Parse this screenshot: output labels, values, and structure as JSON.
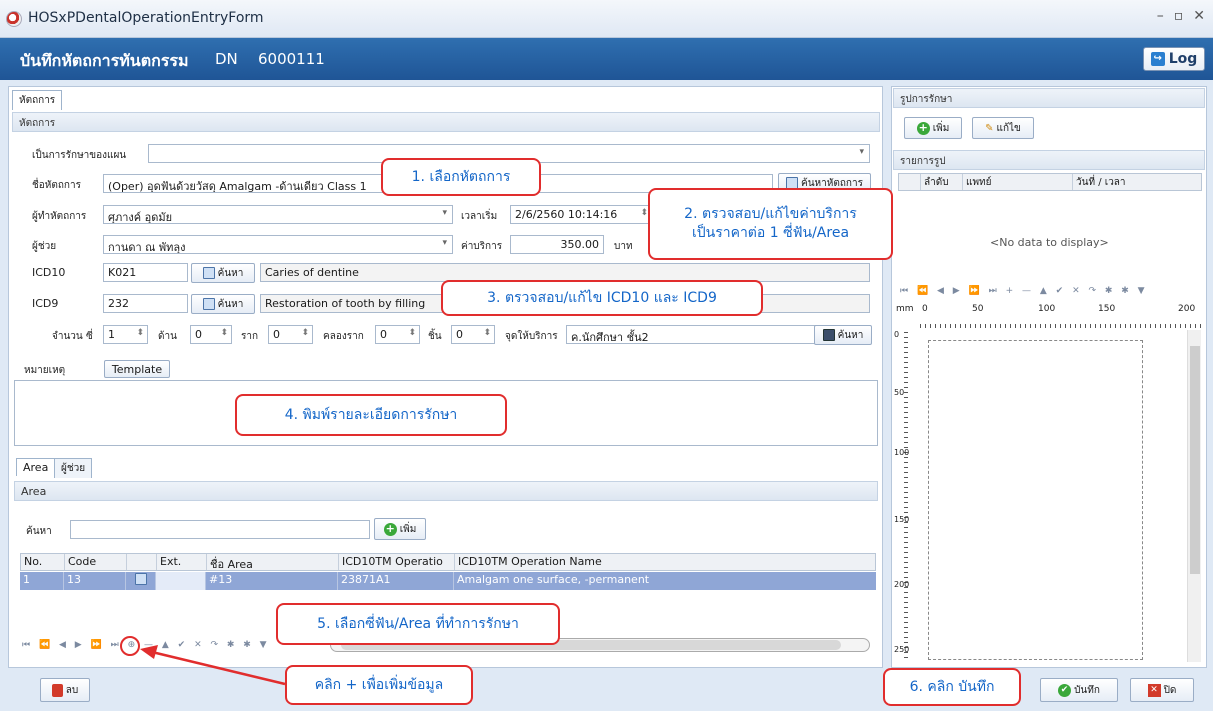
{
  "window": {
    "title": "HOSxPDentalOperationEntryForm",
    "controls": [
      "–",
      "▫",
      "✕"
    ]
  },
  "header": {
    "title": "บันทึกหัตถการทันตกรรม",
    "dn_label": "DN",
    "dn_value": "6000111",
    "log_label": "Log"
  },
  "left": {
    "tab": "หัตถการ",
    "group": "หัตถการ",
    "fields": {
      "plan_label": "เป็นการรักษาของแผน",
      "plan_value": "",
      "proc_label": "ชื่อหัตถการ",
      "proc_value": "(Oper) อุดฟันด้วยวัสดุ Amalgam -ด้านเดียว Class 1",
      "search_proc_btn": "ค้นหาหัตถการ",
      "doer_label": "ผู้ทำหัตถการ",
      "doer_value": "ศุภางค์ อุดมัย",
      "start_label": "เวลาเริ่ม",
      "start_value": "2/6/2560 10:14:16",
      "assistant_label": "ผู้ช่วย",
      "assistant_value": "กานดา ณ พัทลุง",
      "price_label": "ค่าบริการ",
      "price_value": "350.00",
      "price_unit": "บาท",
      "icd10_label": "ICD10",
      "icd10_code": "K021",
      "icd10_name": "Caries of dentine",
      "icd9_label": "ICD9",
      "icd9_code": "232",
      "icd9_name": "Restoration of tooth by filling",
      "search_btn": "ค้นหา",
      "count_label": "จำนวน ซี่",
      "count_value": "1",
      "side_label": "ด้าน",
      "side_value": "0",
      "root_label": "ราก",
      "root_value": "0",
      "canal_label": "คลองราก",
      "canal_value": "0",
      "piece_label": "ชิ้น",
      "piece_value": "0",
      "point_label": "จุดให้บริการ",
      "point_value": "ค.นักศึกษา ชั้น2",
      "search_btn2": "ค้นหา"
    },
    "note_label": "หมายเหตุ",
    "template_btn": "Template",
    "subtabs": [
      "Area",
      "ผู้ช่วย"
    ],
    "area": {
      "group": "Area",
      "search_label": "ค้นหา",
      "add_btn": "เพิ่ม",
      "columns": [
        "No.",
        "Code",
        "",
        "Ext.",
        "ชื่อ Area",
        "ICD10TM Operatio",
        "ICD10TM Operation Name"
      ],
      "rows": [
        {
          "no": "1",
          "code": "13",
          "ext": "",
          "name": "#13",
          "icd": "23871A1",
          "opname": "Amalgam one surface, -permanent"
        }
      ],
      "nav": "⏮ ⏪ ◀ ▶ ⏩ ⏭ ⊕ — ▲ ✔ ✕ ↷ ✱ ✱ ▼"
    },
    "delete_btn": "ลบ"
  },
  "right": {
    "group": "รูปการรักษา",
    "add_btn": "เพิ่ม",
    "edit_btn": "แก้ไข",
    "list_group": "รายการรูป",
    "columns": [
      "ลำดับ",
      "แพทย์",
      "วันที่ / เวลา"
    ],
    "empty": "<No data to display>",
    "nav": "⏮ ⏪ ◀ ▶ ⏩ ⏭ + — ▲ ✔ ✕ ↷ ✱ ✱ ▼",
    "ruler_unit": "mm",
    "ruler_marks": [
      "0",
      "50",
      "100",
      "150",
      "200"
    ],
    "vruler_marks": [
      "0",
      "50",
      "100",
      "150",
      "200",
      "250"
    ],
    "save_btn": "บันทึก",
    "close_btn": "ปิด"
  },
  "annotations": {
    "n1": "1. เลือกหัตถการ",
    "n2a": "2. ตรวจสอบ/แก้ไขค่าบริการ",
    "n2b": "เป็นราคาต่อ 1 ซี่ฟัน/Area",
    "n3": "3. ตรวจสอบ/แก้ไข ICD10 และ ICD9",
    "n4": "4. พิมพ์รายละเอียดการรักษา",
    "n5": "5. เลือกซี่ฟัน/Area ที่ทำการรักษา",
    "n6": "6. คลิก บันทึก",
    "n_plus": "คลิก + เพื่อเพิ่มข้อมูล"
  },
  "colors": {
    "header": "#2363a6",
    "selected_row": "#8fa6d6",
    "callout_border": "#e12d2d",
    "callout_text": "#1466c8"
  }
}
